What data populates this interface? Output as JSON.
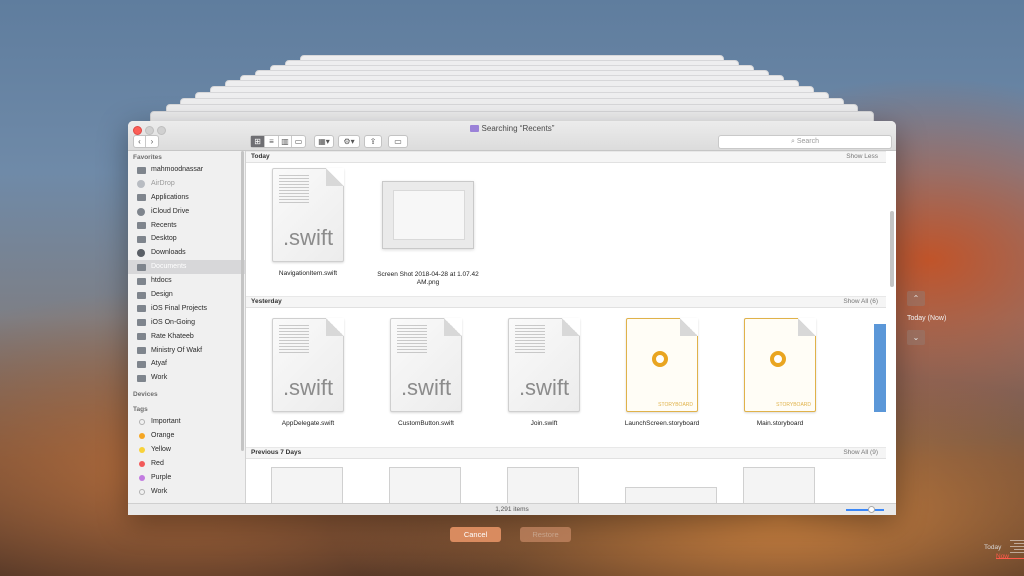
{
  "window": {
    "title": "Searching “Recents”"
  },
  "toolbar": {
    "search_placeholder": "Search",
    "back_icon": "chevron-left-icon",
    "forward_icon": "chevron-right-icon"
  },
  "sidebar": {
    "favorites_heading": "Favorites",
    "favorites": [
      {
        "label": "mahmoodnassar",
        "icon": "home-icon"
      },
      {
        "label": "AirDrop",
        "icon": "airdrop-icon"
      },
      {
        "label": "Applications",
        "icon": "applications-icon"
      },
      {
        "label": "iCloud Drive",
        "icon": "cloud-icon"
      },
      {
        "label": "Recents",
        "icon": "recents-icon"
      },
      {
        "label": "Desktop",
        "icon": "desktop-icon"
      },
      {
        "label": "Downloads",
        "icon": "downloads-icon"
      },
      {
        "label": "Documents",
        "icon": "documents-icon"
      },
      {
        "label": "htdocs",
        "icon": "folder-icon"
      },
      {
        "label": "Design",
        "icon": "folder-icon"
      },
      {
        "label": "iOS Final Projects",
        "icon": "folder-icon"
      },
      {
        "label": "iOS On-Going",
        "icon": "folder-icon"
      },
      {
        "label": "Rate Khateeb",
        "icon": "folder-icon"
      },
      {
        "label": "Ministry Of Wakf",
        "icon": "folder-icon"
      },
      {
        "label": "Atyaf",
        "icon": "folder-icon"
      },
      {
        "label": "Work",
        "icon": "folder-icon"
      }
    ],
    "devices_heading": "Devices",
    "tags_heading": "Tags",
    "tags": [
      {
        "label": "Important",
        "color": "#c8c8c8"
      },
      {
        "label": "Orange",
        "color": "#f5a623"
      },
      {
        "label": "Yellow",
        "color": "#f8d23a"
      },
      {
        "label": "Red",
        "color": "#f25a5a"
      },
      {
        "label": "Purple",
        "color": "#c27ce0"
      },
      {
        "label": "Work",
        "color": "#c8c8c8"
      }
    ]
  },
  "sections": {
    "today": {
      "label": "Today",
      "action": "Show Less",
      "files": [
        {
          "name": "NavigationItem.swift",
          "ext": ".swift"
        },
        {
          "name": "Screen Shot 2018-04-28 at 1.07.42 AM.png"
        }
      ]
    },
    "yesterday": {
      "label": "Yesterday",
      "action": "Show All (6)",
      "files": [
        {
          "name": "AppDelegate.swift",
          "ext": ".swift"
        },
        {
          "name": "CustomButton.swift",
          "ext": ".swift"
        },
        {
          "name": "Join.swift",
          "ext": ".swift"
        },
        {
          "name": "LaunchScreen.storyboard",
          "tag": "STORYBOARD"
        },
        {
          "name": "Main.storyboard",
          "tag": "STORYBOARD"
        }
      ]
    },
    "previous7": {
      "label": "Previous 7 Days",
      "action": "Show All (9)"
    }
  },
  "statusbar": {
    "items": "1,291 items"
  },
  "time_machine": {
    "cancel_label": "Cancel",
    "restore_label": "Restore",
    "current_label": "Today (Now)",
    "up_glyph": "⌃",
    "down_glyph": "⌄",
    "timeline_today": "Today",
    "timeline_now": "Now"
  }
}
